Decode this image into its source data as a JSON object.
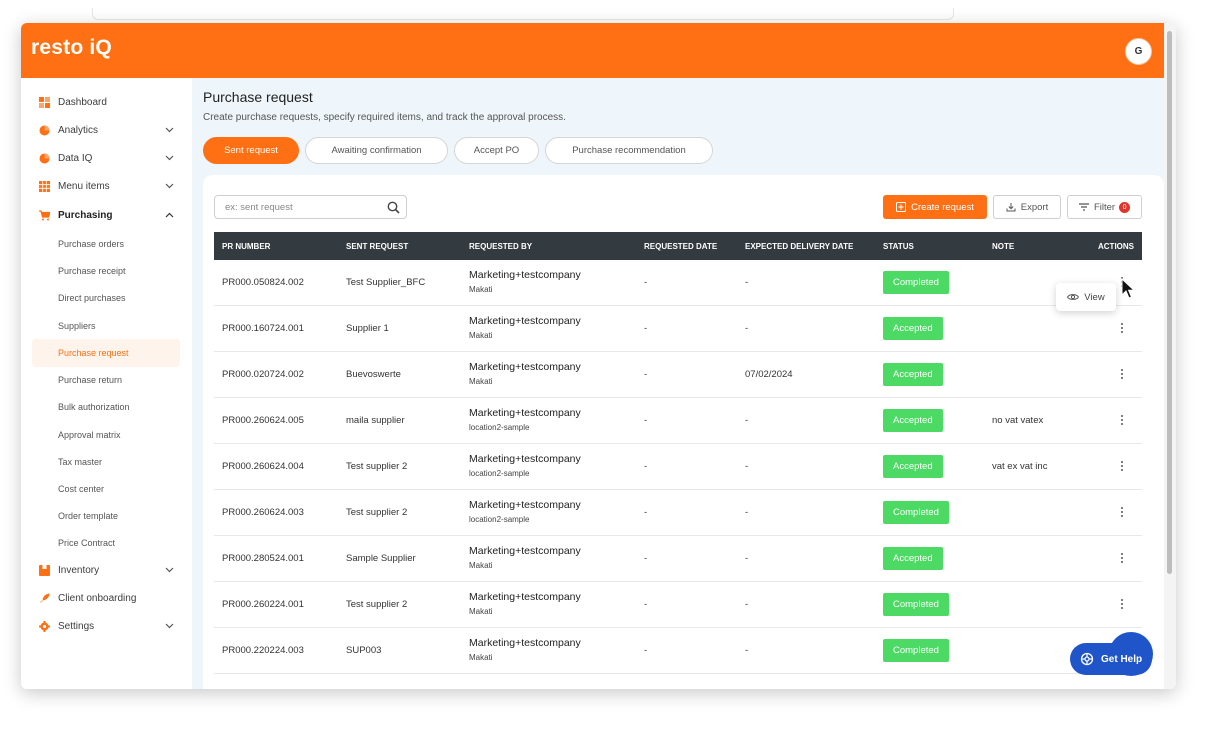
{
  "app": {
    "logo": "resto iQ",
    "avatar_initial": "G"
  },
  "colors": {
    "brand": "#fe7013",
    "accepted": "#4cd964",
    "table_header": "#333a40",
    "help": "#1f55c9"
  },
  "sidebar": {
    "items": [
      {
        "label": "Dashboard",
        "icon": "dashboard-icon"
      },
      {
        "label": "Analytics",
        "icon": "pie-chart-icon"
      },
      {
        "label": "Data IQ",
        "icon": "pie-chart-icon"
      },
      {
        "label": "Menu items",
        "icon": "grid-icon"
      },
      {
        "label": "Purchasing",
        "icon": "cart-icon"
      },
      {
        "label": "Inventory",
        "icon": "box-icon"
      },
      {
        "label": "Client onboarding",
        "icon": "rocket-icon"
      },
      {
        "label": "Settings",
        "icon": "gear-icon"
      }
    ],
    "purchasing_sub": [
      "Purchase orders",
      "Purchase receipt",
      "Direct purchases",
      "Suppliers",
      "Purchase request",
      "Purchase return",
      "Bulk authorization",
      "Approval matrix",
      "Tax master",
      "Cost center",
      "Order template",
      "Price Contract"
    ]
  },
  "page": {
    "title": "Purchase request",
    "subtitle": "Create purchase requests, specify required items, and track the approval process."
  },
  "tabs": [
    "Sent request",
    "Awaiting confirmation",
    "Accept PO",
    "Purchase recommendation"
  ],
  "toolbar": {
    "search_placeholder": "ex: sent request",
    "create_label": "Create request",
    "export_label": "Export",
    "filter_label": "Filter",
    "filter_count": "0"
  },
  "table": {
    "headers": [
      "PR NUMBER",
      "SENT REQUEST",
      "REQUESTED BY",
      "REQUESTED DATE",
      "EXPECTED DELIVERY DATE",
      "STATUS",
      "NOTE",
      "ACTIONS"
    ],
    "rows": [
      {
        "pr": "PR000.050824.002",
        "sent": "Test Supplier_BFC",
        "by": "Marketing+testcompany",
        "loc": "Makati",
        "req_date": "-",
        "exp_date": "-",
        "status": "Completed",
        "note": ""
      },
      {
        "pr": "PR000.160724.001",
        "sent": "Supplier 1",
        "by": "Marketing+testcompany",
        "loc": "Makati",
        "req_date": "-",
        "exp_date": "-",
        "status": "Accepted",
        "note": ""
      },
      {
        "pr": "PR000.020724.002",
        "sent": "Buevoswerte",
        "by": "Marketing+testcompany",
        "loc": "Makati",
        "req_date": "-",
        "exp_date": "07/02/2024",
        "status": "Accepted",
        "note": ""
      },
      {
        "pr": "PR000.260624.005",
        "sent": "maila supplier",
        "by": "Marketing+testcompany",
        "loc": "location2-sample",
        "req_date": "-",
        "exp_date": "-",
        "status": "Accepted",
        "note": "no vat vatex"
      },
      {
        "pr": "PR000.260624.004",
        "sent": "Test supplier 2",
        "by": "Marketing+testcompany",
        "loc": "location2-sample",
        "req_date": "-",
        "exp_date": "-",
        "status": "Accepted",
        "note": "vat ex vat inc"
      },
      {
        "pr": "PR000.260624.003",
        "sent": "Test supplier 2",
        "by": "Marketing+testcompany",
        "loc": "location2-sample",
        "req_date": "-",
        "exp_date": "-",
        "status": "Completed",
        "note": ""
      },
      {
        "pr": "PR000.280524.001",
        "sent": "Sample Supplier",
        "by": "Marketing+testcompany",
        "loc": "Makati",
        "req_date": "-",
        "exp_date": "-",
        "status": "Accepted",
        "note": ""
      },
      {
        "pr": "PR000.260224.001",
        "sent": "Test supplier 2",
        "by": "Marketing+testcompany",
        "loc": "Makati",
        "req_date": "-",
        "exp_date": "-",
        "status": "Completed",
        "note": ""
      },
      {
        "pr": "PR000.220224.003",
        "sent": "SUP003",
        "by": "Marketing+testcompany",
        "loc": "Makati",
        "req_date": "-",
        "exp_date": "-",
        "status": "Completed",
        "note": ""
      }
    ]
  },
  "action_menu": {
    "view_label": "View"
  },
  "help": {
    "label": "Get Help"
  }
}
